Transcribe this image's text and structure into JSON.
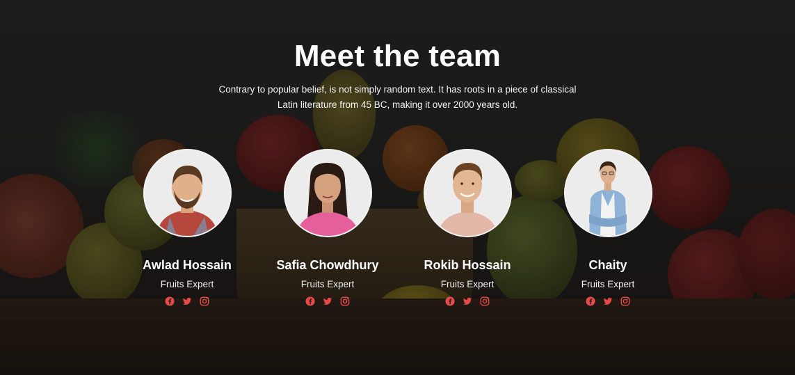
{
  "header": {
    "title": "Meet the team",
    "subtitle": "Contrary to popular belief, is not simply random text. It has roots in a piece of classical Latin literature from 45 BC, making it over 2000 years old."
  },
  "colors": {
    "social_icon": "#e84a4a",
    "text": "#ffffff"
  },
  "team": [
    {
      "name": "Awlad Hossain",
      "role": "Fruits Expert",
      "socials": [
        "facebook-icon",
        "twitter-icon",
        "instagram-icon"
      ]
    },
    {
      "name": "Safia Chowdhury",
      "role": "Fruits Expert",
      "socials": [
        "facebook-icon",
        "twitter-icon",
        "instagram-icon"
      ]
    },
    {
      "name": "Rokib Hossain",
      "role": "Fruits Expert",
      "socials": [
        "facebook-icon",
        "twitter-icon",
        "instagram-icon"
      ]
    },
    {
      "name": "Chaity",
      "role": "Fruits Expert",
      "socials": [
        "facebook-icon",
        "twitter-icon",
        "instagram-icon"
      ]
    }
  ]
}
